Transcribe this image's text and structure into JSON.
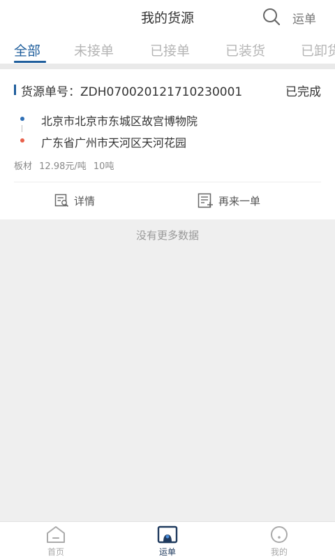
{
  "header": {
    "title": "我的货源",
    "right_link": "运单"
  },
  "tabs": [
    {
      "label": "全部",
      "active": true
    },
    {
      "label": "未接单",
      "active": false
    },
    {
      "label": "已接单",
      "active": false
    },
    {
      "label": "已装货",
      "active": false
    },
    {
      "label": "已卸货",
      "active": false
    }
  ],
  "order": {
    "number_label": "货源单号：ZDH07002012171023000​1",
    "status": "已完成",
    "from_address": "北京市北京市东城区故宫博物院",
    "to_address": "广东省广州市天河区天河花园",
    "cargo_type": "板材",
    "price": "12.98元/吨",
    "weight": "10吨",
    "details_label": "详情",
    "reorder_label": "再来一单"
  },
  "list_footer": "没有更多数据",
  "bottom_nav": [
    {
      "label": "首页",
      "icon": "home-icon",
      "active": false
    },
    {
      "label": "运单",
      "icon": "waybill-icon",
      "active": true
    },
    {
      "label": "我的",
      "icon": "profile-icon",
      "active": false
    }
  ],
  "colors": {
    "accent": "#1f5e9c",
    "from_dot": "#2f6fb5",
    "to_dot": "#e8604a",
    "background": "#efefef"
  }
}
